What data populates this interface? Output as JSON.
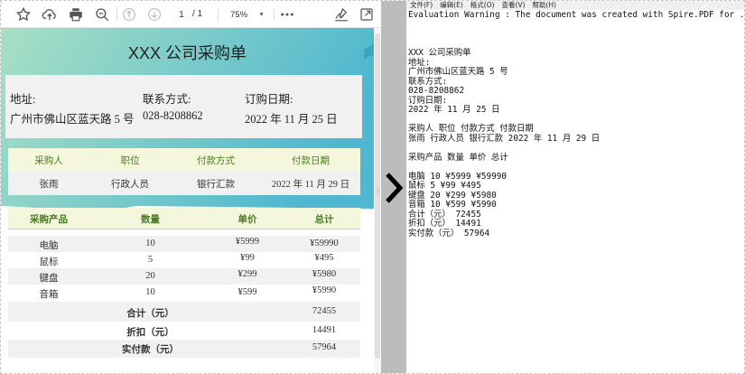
{
  "pdf_viewer": {
    "current_page": "1",
    "page_total": "/ 1",
    "zoom": "75%",
    "document": {
      "title": "XXX 公司采购单",
      "info": {
        "address_label": "地址:",
        "address_value": "广州市佛山区蓝天路 5 号",
        "contact_label": "联系方式:",
        "contact_value": "028-8208862",
        "date_label": "订购日期:",
        "date_value": "2022 年 11 月 25 日"
      },
      "buyer_headers": [
        "采购人",
        "职位",
        "付款方式",
        "付款日期"
      ],
      "buyer_row": [
        "张雨",
        "行政人员",
        "银行汇款",
        "2022 年 11 月 29 日"
      ],
      "item_headers": [
        "采购产品",
        "数量",
        "单价",
        "总计"
      ],
      "items": [
        [
          "电脑",
          "10",
          "¥5999",
          "¥59990"
        ],
        [
          "鼠标",
          "5",
          "¥99",
          "¥495"
        ],
        [
          "键盘",
          "20",
          "¥299",
          "¥5980"
        ],
        [
          "音箱",
          "10",
          "¥599",
          "¥5990"
        ]
      ],
      "totals": [
        {
          "label": "合计（元）",
          "value": "72455"
        },
        {
          "label": "折扣（元）",
          "value": "14491"
        },
        {
          "label": "实付款（元）",
          "value": "57964"
        }
      ]
    }
  },
  "colors": {
    "teal_gradient_start": "#a8e0c4",
    "teal_gradient_end": "#4fb7cf",
    "header_band": "#f4f7dc",
    "header_text": "#4a7a22",
    "row_alt": "#f1f1f1"
  },
  "editor": {
    "menu": [
      "文件(F)",
      "编辑(E)",
      "格式(O)",
      "查看(V)",
      "帮助(H)"
    ],
    "lines": [
      "Evaluation Warning : The document was created with Spire.PDF for .NET.",
      "",
      "",
      "",
      "XXX 公司采购单",
      "地址:",
      "广州市佛山区蓝天路 5 号",
      "联系方式:",
      "028-8208862",
      "订购日期:",
      "2022 年 11 月 25 日",
      "",
      "采购人 职位 付款方式 付款日期",
      "张雨 行政人员 银行汇款 2022 年 11 月 29 日",
      "",
      "采购产品 数量 单价 总计",
      "",
      "电脑 10 ¥5999 ¥59990",
      "鼠标 5 ¥99 ¥495",
      "键盘 20 ¥299 ¥5980",
      "音箱 10 ¥599 ¥5990",
      "合计（元） 72455",
      "折扣（元） 14491",
      "实付款（元） 57964"
    ]
  }
}
